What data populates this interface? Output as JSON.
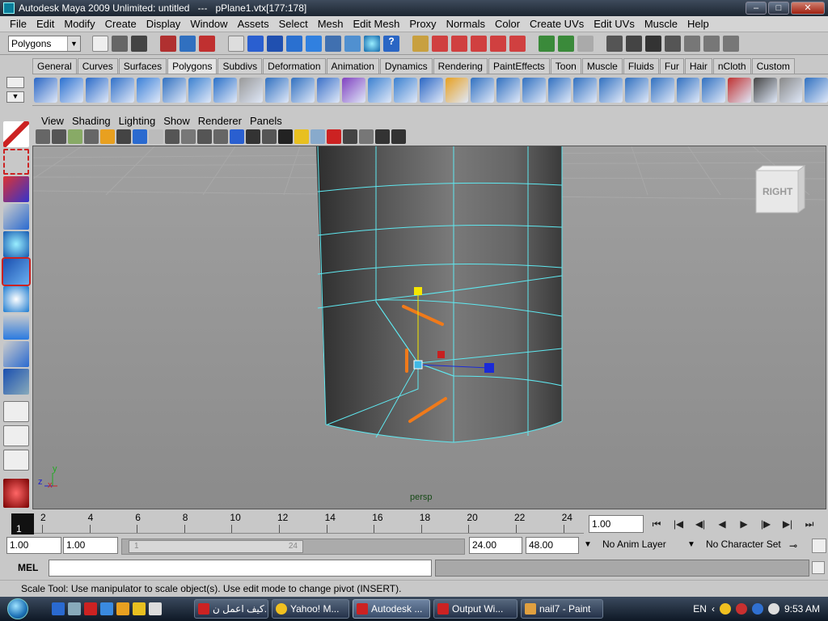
{
  "window": {
    "title": "Autodesk Maya 2009 Unlimited: untitled   ---   pPlane1.vtx[177:178]",
    "min": "–",
    "max": "□",
    "close": "✕"
  },
  "menus": [
    "File",
    "Edit",
    "Modify",
    "Create",
    "Display",
    "Window",
    "Assets",
    "Select",
    "Mesh",
    "Edit Mesh",
    "Proxy",
    "Normals",
    "Color",
    "Create UVs",
    "Edit UVs",
    "Muscle",
    "Help"
  ],
  "statusline": {
    "menuset": "Polygons"
  },
  "shelf_tabs": [
    "General",
    "Curves",
    "Surfaces",
    "Polygons",
    "Subdivs",
    "Deformation",
    "Animation",
    "Dynamics",
    "Rendering",
    "PaintEffects",
    "Toon",
    "Muscle",
    "Fluids",
    "Fur",
    "Hair",
    "nCloth",
    "Custom"
  ],
  "active_shelf": "Polygons",
  "panel_menus": [
    "View",
    "Shading",
    "Lighting",
    "Show",
    "Renderer",
    "Panels"
  ],
  "viewport": {
    "camera_label": "persp",
    "viewcube_label": "RIGHT",
    "axis": {
      "z": "z",
      "x": "x",
      "y": "y"
    }
  },
  "timeline": {
    "ticks": [
      "2",
      "4",
      "6",
      "8",
      "10",
      "12",
      "14",
      "16",
      "18",
      "20",
      "22",
      "24"
    ],
    "current_frame": "1",
    "current_time_field": "1.00"
  },
  "playback_buttons": [
    "go-to-start",
    "step-back-frame",
    "step-back-key",
    "play-backwards",
    "play-forwards",
    "step-forward-key",
    "step-forward-frame",
    "go-to-end"
  ],
  "range": {
    "start": "1.00",
    "playback_start": "1.00",
    "slider_start": "1",
    "slider_end": "24",
    "playback_end": "24.00",
    "end": "48.00",
    "anim_layer": "No Anim Layer",
    "character_set": "No Character Set"
  },
  "command": {
    "label": "MEL"
  },
  "help_line": "Scale Tool: Use manipulator to scale object(s). Use edit mode to change pivot (INSERT).",
  "taskbar": {
    "tasks": [
      "كيف اعمل ن...",
      "Yahoo! M...",
      "Autodesk ...",
      "Output Wi...",
      "nail7 - Paint"
    ],
    "language": "EN",
    "clock": "9:53 AM"
  },
  "colors": {
    "wire": "#5fe8f0",
    "accent_orange": "#f07a1a",
    "manip_yellow": "#f5e600",
    "manip_blue": "#1a2ad8",
    "manip_red": "#c82020",
    "manip_cyan": "#3fb8e6"
  }
}
